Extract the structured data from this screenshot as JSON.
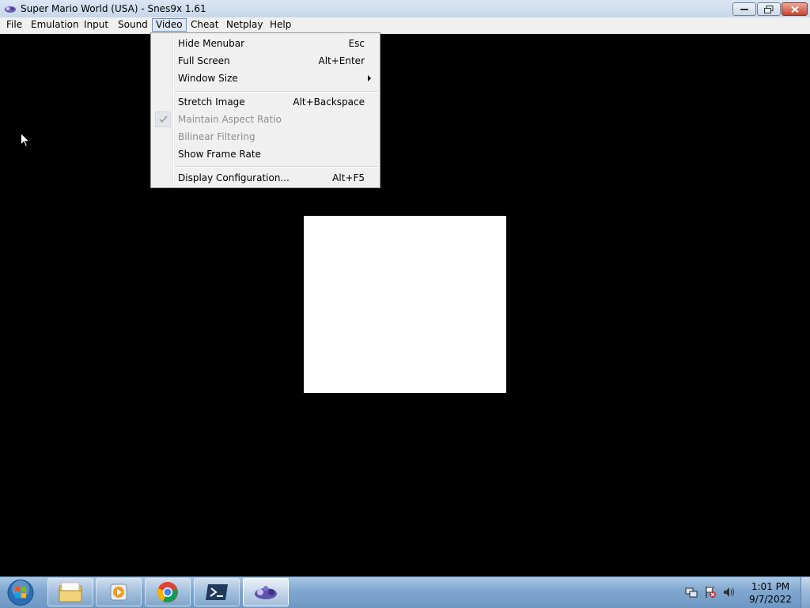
{
  "window": {
    "title": "Super Mario World (USA) - Snes9x 1.61",
    "icon": "snes9x-app-icon"
  },
  "menubar": {
    "items": [
      "File",
      "Emulation",
      "Input",
      "Sound",
      "Video",
      "Cheat",
      "Netplay",
      "Help"
    ],
    "active": "Video"
  },
  "video_menu": {
    "items": [
      {
        "label": "Hide Menubar",
        "shortcut": "Esc"
      },
      {
        "label": "Full Screen",
        "shortcut": "Alt+Enter"
      },
      {
        "label": "Window Size",
        "submenu": true
      },
      {
        "label": "Stretch Image",
        "shortcut": "Alt+Backspace"
      },
      {
        "label": "Maintain Aspect Ratio",
        "checked": true,
        "disabled": true
      },
      {
        "label": "Bilinear Filtering",
        "disabled": true
      },
      {
        "label": "Show Frame Rate"
      },
      {
        "label": "Display Configuration...",
        "shortcut": "Alt+F5"
      }
    ]
  },
  "taskbar": {
    "pinned": [
      "windows-explorer-icon",
      "media-player-icon",
      "chrome-icon",
      "powershell-icon",
      "snes9x-icon"
    ],
    "tray": [
      "network-icon",
      "action-center-flag-icon",
      "volume-icon"
    ],
    "clock": {
      "time": "1:01 PM",
      "date": "9/7/2022"
    }
  }
}
